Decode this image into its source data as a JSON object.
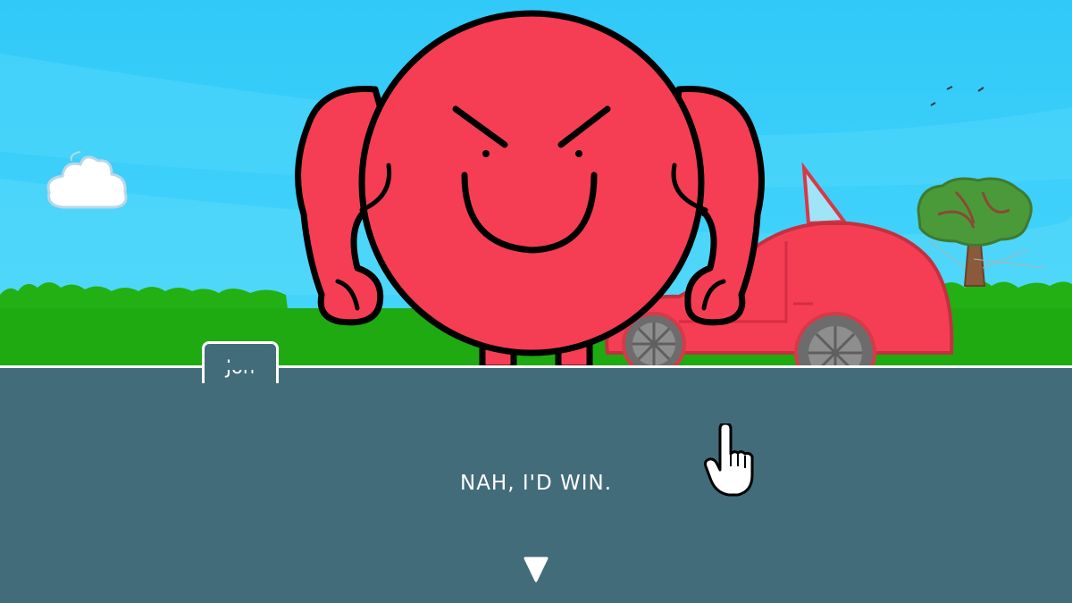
{
  "speaker": {
    "name": "Jon"
  },
  "dialog": {
    "text": "NAH, I'D WIN."
  },
  "scene": {
    "sky_color": "#3cc8f5",
    "grass_color": "#22b014",
    "character_color": "#f53e54",
    "car_color": "#f53e54",
    "dialog_bg_color": "#436c7a"
  },
  "icons": {
    "advance": "triangle-down-icon",
    "cursor": "hand-pointer-icon"
  }
}
